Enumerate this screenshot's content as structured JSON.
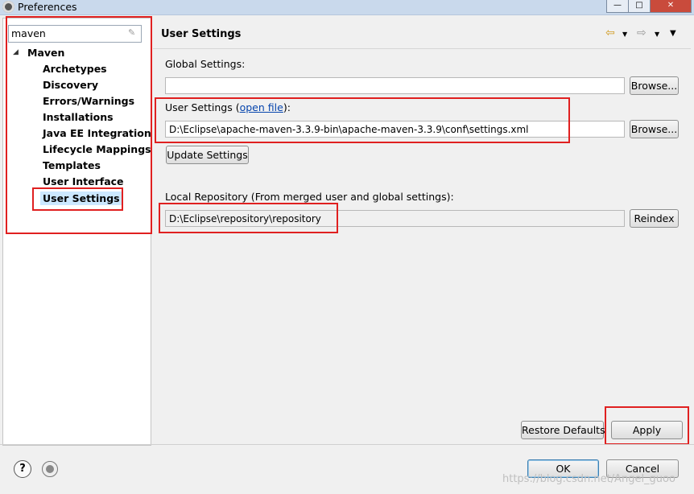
{
  "window": {
    "title": "Preferences",
    "minimize": "—",
    "maximize": "□",
    "close": "✕"
  },
  "filter": {
    "value": "maven"
  },
  "tree": {
    "root": "Maven",
    "items": [
      "Archetypes",
      "Discovery",
      "Errors/Warnings",
      "Installations",
      "Java EE Integration",
      "Lifecycle Mappings",
      "Templates",
      "User Interface",
      "User Settings"
    ],
    "selected": "User Settings"
  },
  "page": {
    "title": "User Settings",
    "global_settings_label": "Global Settings:",
    "global_settings_value": "",
    "browse_label": "Browse...",
    "user_settings_label_prefix": "User Settings (",
    "user_settings_link": "open file",
    "user_settings_label_suffix": "):",
    "user_settings_value": "D:\\Eclipse\\apache-maven-3.3.9-bin\\apache-maven-3.3.9\\conf\\settings.xml",
    "update_settings_label": "Update Settings",
    "local_repo_label": "Local Repository (From merged user and global settings):",
    "local_repo_value": "D:\\Eclipse\\repository\\repository",
    "reindex_label": "Reindex",
    "restore_defaults_label": "Restore Defaults",
    "apply_label": "Apply"
  },
  "footer": {
    "ok_label": "OK",
    "cancel_label": "Cancel",
    "help_symbol": "?",
    "watermark": "https://blog.csdn.net/Angel_guoo"
  },
  "icons": {
    "back": "⇦",
    "forward": "⇨",
    "dropdown": "▼",
    "tree_expanded": "◢",
    "clear": "✎"
  },
  "colors": {
    "highlight_box": "#e02020",
    "link": "#0645ad",
    "selection": "#cce8ff"
  }
}
